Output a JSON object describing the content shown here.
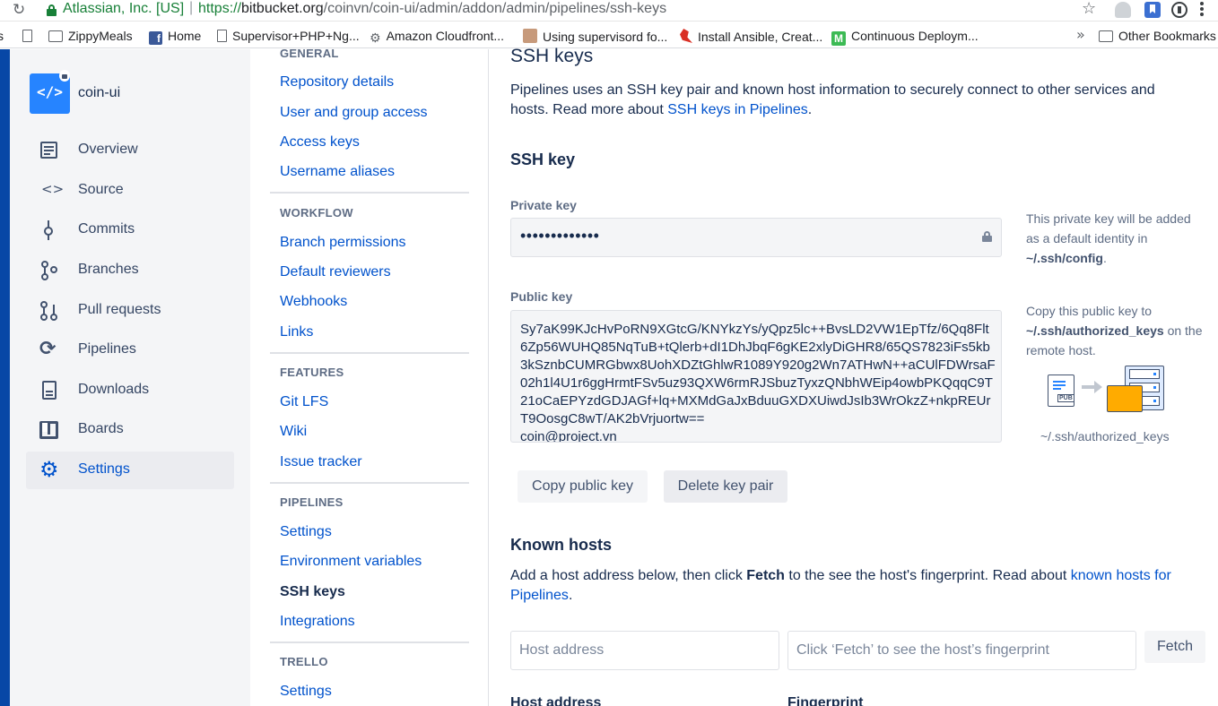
{
  "browser": {
    "org": "Atlassian, Inc. [US]",
    "url_scheme": "https://",
    "url_host": "bitbucket.org",
    "url_path": "/coinvn/coin-ui/admin/addon/admin/pipelines/ssh-keys",
    "bookmarks": [
      {
        "label": "ZippyMeals",
        "icon": "folder-icon"
      },
      {
        "label": "Home",
        "icon": "facebook-icon"
      },
      {
        "label": "Supervisor+PHP+Ng...",
        "icon": "page-icon"
      },
      {
        "label": "Amazon Cloudfront...",
        "icon": "gear-icon"
      },
      {
        "label": "Using supervisord fo...",
        "icon": "avatar-icon"
      },
      {
        "label": "Install Ansible, Creat...",
        "icon": "bird-icon"
      },
      {
        "label": "Continuous Deploym...",
        "icon": "m-icon"
      },
      {
        "label": "Other Bookmarks",
        "icon": "folder-icon"
      }
    ]
  },
  "repo": {
    "name": "coin-ui"
  },
  "sidebar": {
    "items": [
      {
        "label": "Overview"
      },
      {
        "label": "Source"
      },
      {
        "label": "Commits"
      },
      {
        "label": "Branches"
      },
      {
        "label": "Pull requests"
      },
      {
        "label": "Pipelines"
      },
      {
        "label": "Downloads"
      },
      {
        "label": "Boards"
      },
      {
        "label": "Settings"
      }
    ]
  },
  "settings_nav": {
    "general": {
      "title": "GENERAL",
      "links": [
        "Repository details",
        "User and group access",
        "Access keys",
        "Username aliases"
      ]
    },
    "workflow": {
      "title": "WORKFLOW",
      "links": [
        "Branch permissions",
        "Default reviewers",
        "Webhooks",
        "Links"
      ]
    },
    "features": {
      "title": "FEATURES",
      "links": [
        "Git LFS",
        "Wiki",
        "Issue tracker"
      ]
    },
    "pipelines": {
      "title": "PIPELINES",
      "links": [
        "Settings",
        "Environment variables",
        "SSH keys",
        "Integrations"
      ]
    },
    "trello": {
      "title": "TRELLO",
      "links": [
        "Settings"
      ]
    }
  },
  "main": {
    "title": "SSH keys",
    "intro_text": "Pipelines uses an SSH key pair and known host information to securely connect to other services and hosts. Read more about ",
    "intro_link": "SSH keys in Pipelines",
    "intro_end": ".",
    "ssh_key_heading": "SSH key",
    "private_key_label": "Private key",
    "private_key_value": "•••••••••••••",
    "private_help_1": "This private key will be added as a default identity in ",
    "private_help_path": "~/.ssh/config",
    "private_help_end": ".",
    "public_key_label": "Public key",
    "public_key_value": "Sy7aK99KJcHvPoRN9XGtcG/KNYkzYs/yQpz5lc++BvsLD2VW1EpTfz/6Qq8Flt6Zp56WUHQ85NqTuB+tQlerb+dI1DhJbqF6gKE2xlyDiGHR8/65QS7823iFs5kb3kSznbCUMRGbwx8UohXDZtGhlwR1089Y920g2Wn7ATHwN++aCUlFDWrsaF02h1l4U1r6ggHrmtFSv5uz93QXW6rmRJSbuzTyxzQNbhWEip4owbPKQqqC9T21oCaEPYzdGDJAGf+lq+MXMdGaJxBduuGXDXUiwdJsIb3WrOkzZ+nkpREUrT9OosgC8wT/AK2bVrjuortw==",
    "public_key_comment": "coin@project.vn",
    "public_help_1": "Copy this public key to ",
    "public_help_path": "~/.ssh/authorized_keys",
    "public_help_2": " on the remote host.",
    "illustration_caption": "~/.ssh/authorized_keys",
    "illustration_badge": "PUB",
    "copy_button": "Copy public key",
    "delete_button": "Delete key pair",
    "known_hosts_heading": "Known hosts",
    "known_text_1": "Add a host address below, then click ",
    "known_text_bold": "Fetch",
    "known_text_2": " to the see the host's fingerprint. Read about ",
    "known_text_link": "known hosts for Pipelines",
    "known_text_end": ".",
    "host_placeholder": "Host address",
    "fingerprint_placeholder": "Click ‘Fetch’ to see the host’s fingerprint",
    "fetch_button": "Fetch",
    "col_host": "Host address",
    "col_fingerprint": "Fingerprint"
  }
}
